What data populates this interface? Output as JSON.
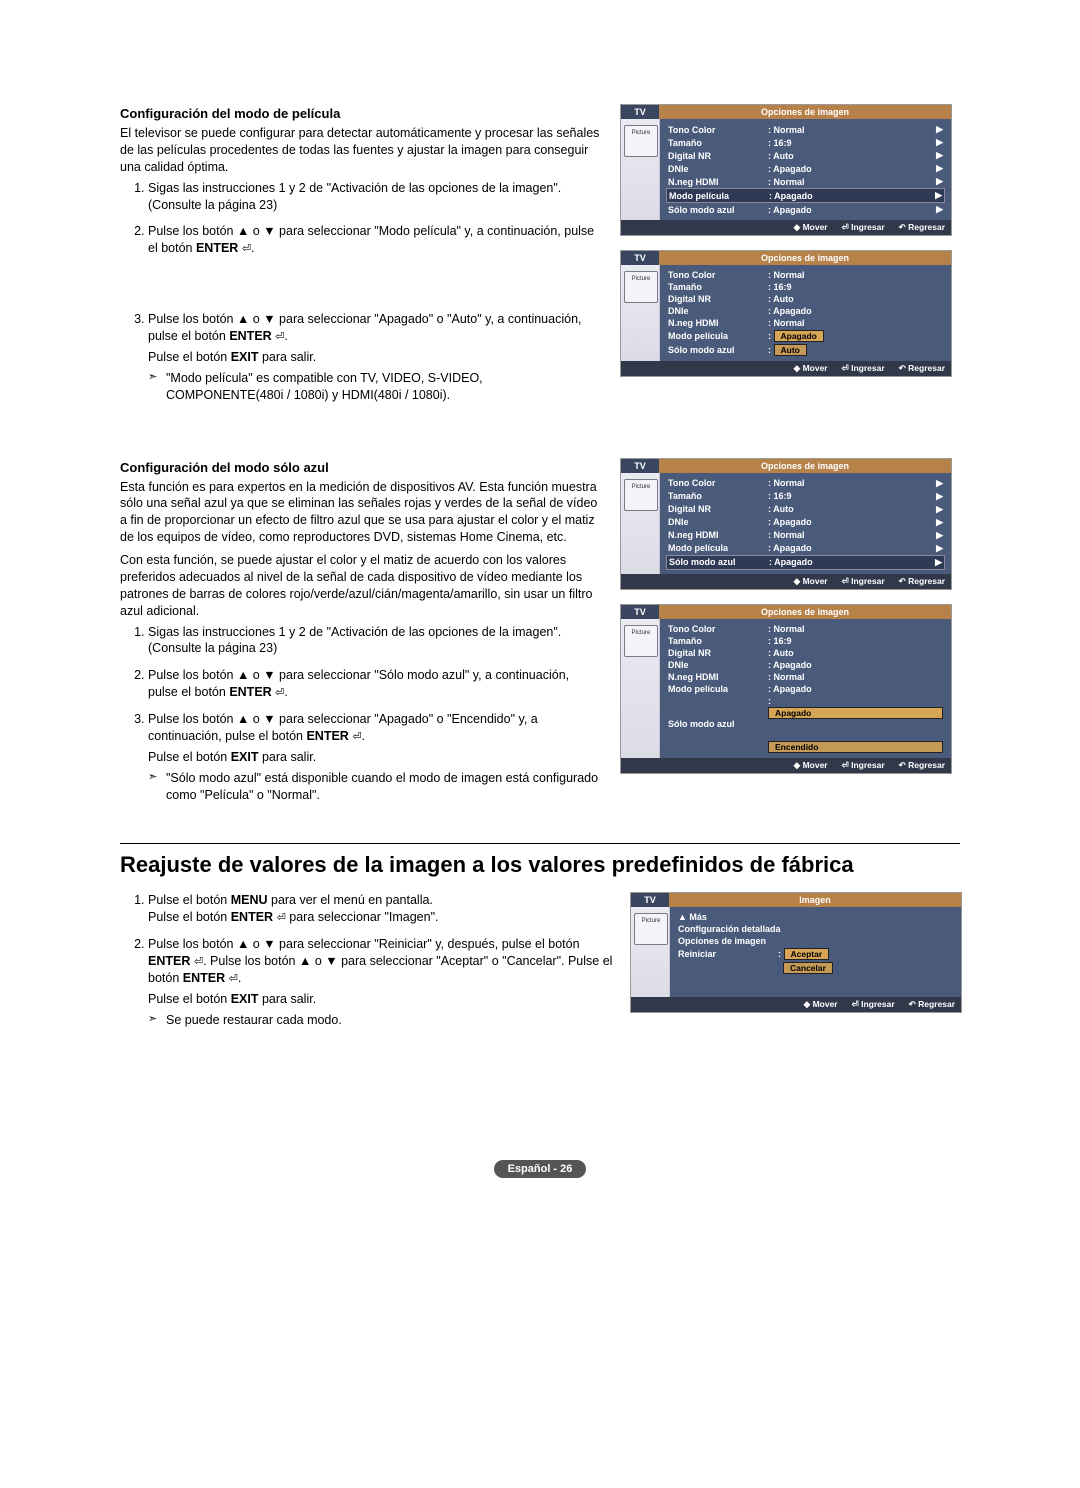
{
  "section1": {
    "title": "Configuración del modo de película",
    "intro": "El televisor se puede configurar para detectar automáticamente y procesar las señales de las películas procedentes de todas las fuentes y ajustar la imagen para conseguir una calidad óptima.",
    "step1": "Sigas las instrucciones 1 y 2 de \"Activación de las opciones de la imagen\". (Consulte la página 23)",
    "step2a": "Pulse los botón ▲ o ▼ para seleccionar \"Modo película\" y, a continuación, pulse el botón ",
    "step2b": "ENTER",
    "step2c": ".",
    "step3a": "Pulse los botón ▲ o ▼ para seleccionar \"Apagado\" o \"Auto\" y, a continuación, pulse el botón ",
    "step3b": "ENTER",
    "step3c": ".",
    "exit": "Pulse el botón EXIT para salir.",
    "note": "\"Modo película\" es compatible con TV, VIDEO, S-VIDEO, COMPONENTE(480i / 1080i) y HDMI(480i / 1080i)."
  },
  "section2": {
    "title": "Configuración del modo sólo azul",
    "intro1": "Esta función es para expertos en la medición de dispositivos AV. Esta función muestra sólo una señal azul ya que se eliminan las señales rojas y verdes de la señal de vídeo a fin de proporcionar un efecto de filtro azul que se usa para ajustar el color y el matiz de los equipos de vídeo, como reproductores DVD, sistemas Home Cinema, etc.",
    "intro2": "Con esta función, se puede ajustar el color y el matiz de acuerdo con los valores preferidos adecuados al nivel de la señal de cada dispositivo de vídeo mediante los patrones de barras de colores rojo/verde/azul/cián/magenta/amarillo, sin usar un filtro azul adicional.",
    "step1": "Sigas las instrucciones 1 y 2 de \"Activación de las opciones de la imagen\". (Consulte la página 23)",
    "step2a": "Pulse los botón ▲ o ▼ para seleccionar \"Sólo modo azul\" y, a continuación, pulse el botón ",
    "step2b": "ENTER",
    "step2c": ".",
    "step3a": "Pulse los botón ▲ o ▼ para seleccionar \"Apagado\" o \"Encendido\" y, a continuación, pulse el botón ",
    "step3b": "ENTER",
    "step3c": ".",
    "exit": "Pulse el botón EXIT para salir.",
    "note": "\"Sólo modo azul\" está disponible cuando el modo de imagen está configurado como \"Película\" o \"Normal\"."
  },
  "section3": {
    "title": "Reajuste de valores de la imagen a los valores predefinidos de fábrica",
    "step1a": "Pulse el botón ",
    "step1b": "MENU",
    "step1c": " para ver el menú en pantalla.",
    "step1d": "Pulse el botón ",
    "step1e": "ENTER",
    "step1f": " para seleccionar \"Imagen\".",
    "step2a": "Pulse los botón ▲ o ▼ para seleccionar \"Reiniciar\" y, después, pulse el botón ",
    "step2b": "ENTER",
    "step2c": ". Pulse los botón ▲ o ▼ para seleccionar \"Aceptar\" o \"Cancelar\". Pulse el botón ",
    "step2d": "ENTER",
    "step2e": ".",
    "exit": "Pulse el botón EXIT para salir.",
    "note": "Se puede restaurar cada modo."
  },
  "osd_common": {
    "tv": "TV",
    "picture": "Picture",
    "title_opciones": "Opciones de imagen",
    "title_imagen": "Imagen",
    "mover": "Mover",
    "ingresar": "Ingresar",
    "regresar": "Regresar",
    "tono": "Tono Color",
    "tamano": "Tamaño",
    "digitalnr": "Digital NR",
    "dnie": "DNIe",
    "nneg": "N.neg HDMI",
    "modo_pelicula": "Modo película",
    "solo_azul": "Sólo modo azul",
    "mas": "▲ Más",
    "conf_det": "Configuración detallada",
    "opc_img": "Opciones de imagen",
    "reiniciar": "Reiniciar",
    "normal": "Normal",
    "v169": "16:9",
    "auto": "Auto",
    "apagado": "Apagado",
    "encendido": "Encendido",
    "aceptar": "Aceptar",
    "cancelar": "Cancelar",
    "colon": ": "
  },
  "footer": "Español - 26"
}
